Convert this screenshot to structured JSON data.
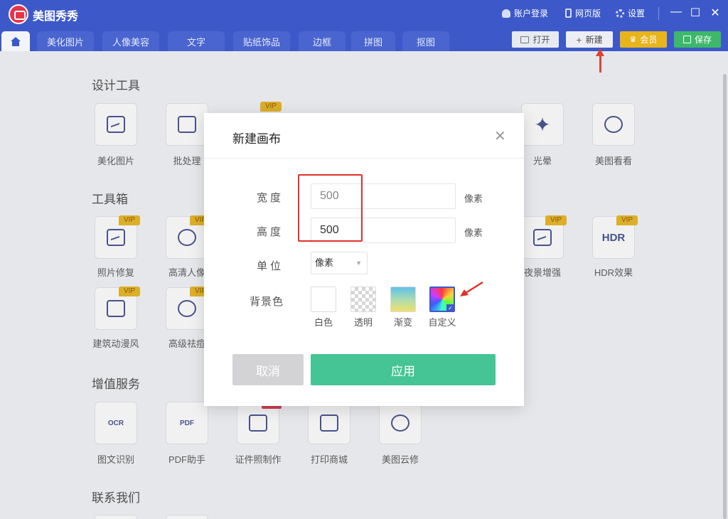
{
  "app": {
    "title": "美图秀秀"
  },
  "titlebar": {
    "account": "账户登录",
    "web": "网页版",
    "settings": "设置"
  },
  "tabs": [
    "美化图片",
    "人像美容",
    "文字",
    "贴纸饰品",
    "边框",
    "拼图",
    "抠图"
  ],
  "topbuttons": {
    "open": "打开",
    "new": "新建",
    "vip": "会员",
    "save": "保存"
  },
  "sections": {
    "design": "设计工具",
    "toolbox": "工具箱",
    "value_added": "增值服务",
    "contact": "联系我们"
  },
  "design_tools": [
    {
      "label": "美化图片"
    },
    {
      "label": "批处理"
    },
    {
      "label": "光晕"
    },
    {
      "label": "美图看看"
    }
  ],
  "toolbox": [
    {
      "label": "照片修复",
      "badge": "VIP"
    },
    {
      "label": "高清人像",
      "badge": "VIP"
    },
    {
      "label": "夜景增强",
      "badge": "VIP"
    },
    {
      "label": "HDR效果",
      "badge": "VIP",
      "glyph": "HDR"
    },
    {
      "label": "建筑动漫风",
      "badge": "VIP"
    },
    {
      "label": "高级祛痘",
      "badge": "VIP"
    }
  ],
  "value_added": [
    {
      "label": "图文识别",
      "glyph": "OCR"
    },
    {
      "label": "PDF助手",
      "glyph": "PDF"
    },
    {
      "label": "证件照制作",
      "badge": "HOT"
    },
    {
      "label": "打印商城"
    },
    {
      "label": "美图云修"
    }
  ],
  "badges": {
    "vip": "VIP"
  },
  "modal": {
    "title": "新建画布",
    "width_label": "宽度",
    "width_value": "500",
    "height_label": "高度",
    "height_value": "500",
    "unit_suffix": "像素",
    "unit_label": "单位",
    "unit_value": "像素",
    "bg_label": "背景色",
    "bg_options": [
      "白色",
      "透明",
      "渐变",
      "自定义"
    ],
    "cancel": "取消",
    "apply": "应用"
  },
  "colors": {
    "accent": "#3d59c9",
    "apply": "#45c596",
    "vip": "#e8b41c",
    "save": "#3db86a",
    "annotation": "#e0302a"
  }
}
